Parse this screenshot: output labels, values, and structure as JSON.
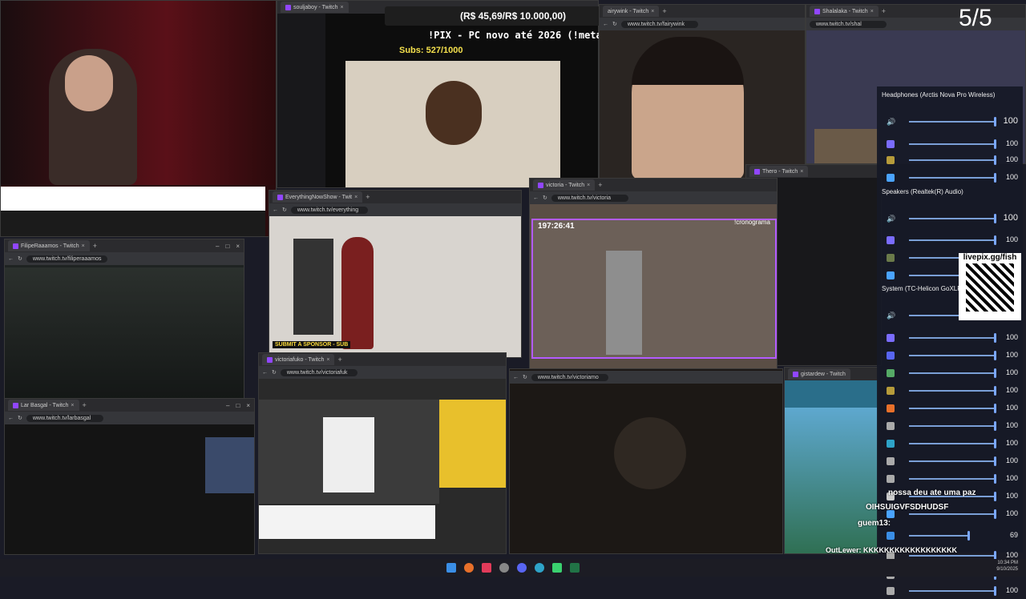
{
  "overlays": {
    "donation_bar": "(R$ 45,69/R$ 10.000,00)",
    "stream_title": "!PIX - PC novo até 2026 (!meta)",
    "subs": "Subs: 527/1000",
    "page_counter": "5/5",
    "timer": "197:26:41",
    "crono": "!cronograma",
    "sponsor": "SUBMIT A SPONSOR - SUB",
    "livepix": "livepix.gg/fish"
  },
  "windows": {
    "soulja": {
      "tab": "souljaboy - Twitch"
    },
    "fairy": {
      "tab": "airywink - Twitch",
      "url": "www.twitch.tv/fairywink"
    },
    "shala": {
      "tab": "Shalalaka - Twitch",
      "url": "www.twitch.tv/shal"
    },
    "filipe": {
      "tab": "FilipeRaaamos - Twitch",
      "url": "www.twitch.tv/filiperaaamos"
    },
    "everything": {
      "tab": "EverythingNowShow - Twit",
      "url": "www.twitch.tv/everything"
    },
    "victoria": {
      "tab": "victoria - Twitch",
      "url": "www.twitch.tv/victoria"
    },
    "thero": {
      "tab": "Thero - Twitch"
    },
    "victoriafuko": {
      "tab": "victoriafuko - Twitch",
      "url": "www.twitch.tv/victoriafuk"
    },
    "victoriamo": {
      "url": "www.twitch.tv/victoriamo"
    },
    "larbasgal": {
      "tab": "Lar Basgal - Twitch",
      "url": "www.twitch.tv/larbasgal"
    },
    "gistardew": {
      "tab": "gistardew - Twitch"
    }
  },
  "mixer": {
    "devices": [
      "Headphones (Arctis Nova Pro Wireless)",
      "Speakers (Realtek(R) Audio)",
      "System (TC-Helicon GoXLR)"
    ],
    "values": [
      "100",
      "100",
      "100",
      "100",
      "100",
      "100",
      "100",
      "100",
      "100",
      "100",
      "100",
      "100",
      "100",
      "100",
      "100",
      "100",
      "100",
      "100",
      "100",
      "100",
      "69",
      "100",
      "100",
      "100"
    ]
  },
  "chat": {
    "lines": [
      "nossa deu ate uma paz",
      "OIHSUIGVFSDHUDSF",
      "guem13:",
      "OutLewer: KKKKKKKKKKKKKKKKKK"
    ]
  },
  "tray": {
    "time": "10:34 PM",
    "date": "9/10/2025"
  },
  "colors": {
    "twitch": "#9146ff",
    "accent": "#7aa7ff"
  }
}
